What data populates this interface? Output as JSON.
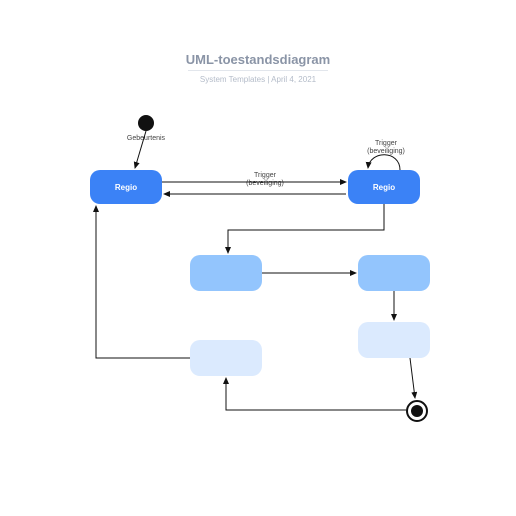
{
  "header": {
    "title": "UML-toestandsdiagram",
    "subtitle": "System Templates  |  April 4, 2021"
  },
  "nodes": {
    "initial_label": "Gebeurtenis",
    "regio_left": "Regio",
    "regio_right": "Regio"
  },
  "edges": {
    "trigger_top": "Trigger",
    "guard_top": "(beveiliging)",
    "trigger_self": "Trigger",
    "guard_self": "(beveiliging)"
  }
}
